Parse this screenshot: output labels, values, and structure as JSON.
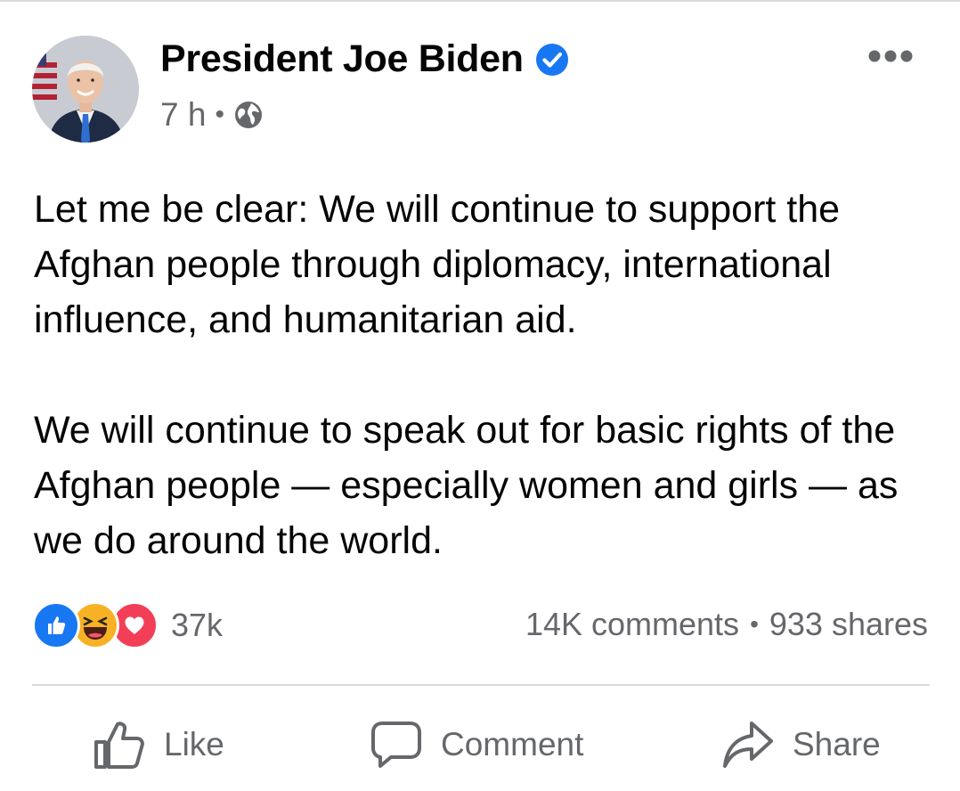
{
  "post": {
    "author": "President Joe Biden",
    "verified": true,
    "time": "7 h",
    "meta_separator": "•",
    "audience_icon": "globe-icon",
    "paragraphs": [
      "Let me be clear: We will continue to support the Afghan people through diplomacy, international influence, and humanitarian aid.",
      "We will continue to speak out for basic rights of the Afghan people — especially women and girls — as we do around the world."
    ]
  },
  "reactions": {
    "icons": [
      "like-icon",
      "haha-icon",
      "love-icon"
    ],
    "count": "37k"
  },
  "engagement": {
    "comments": "14K comments",
    "separator": "•",
    "shares": "933 shares"
  },
  "actions": {
    "like": "Like",
    "comment": "Comment",
    "share": "Share"
  },
  "colors": {
    "verified_blue": "#1877f2",
    "secondary_text": "#65676b",
    "like_blue": "#1877f2",
    "haha_yellow": "#f7b125",
    "love_red": "#f33e58"
  }
}
